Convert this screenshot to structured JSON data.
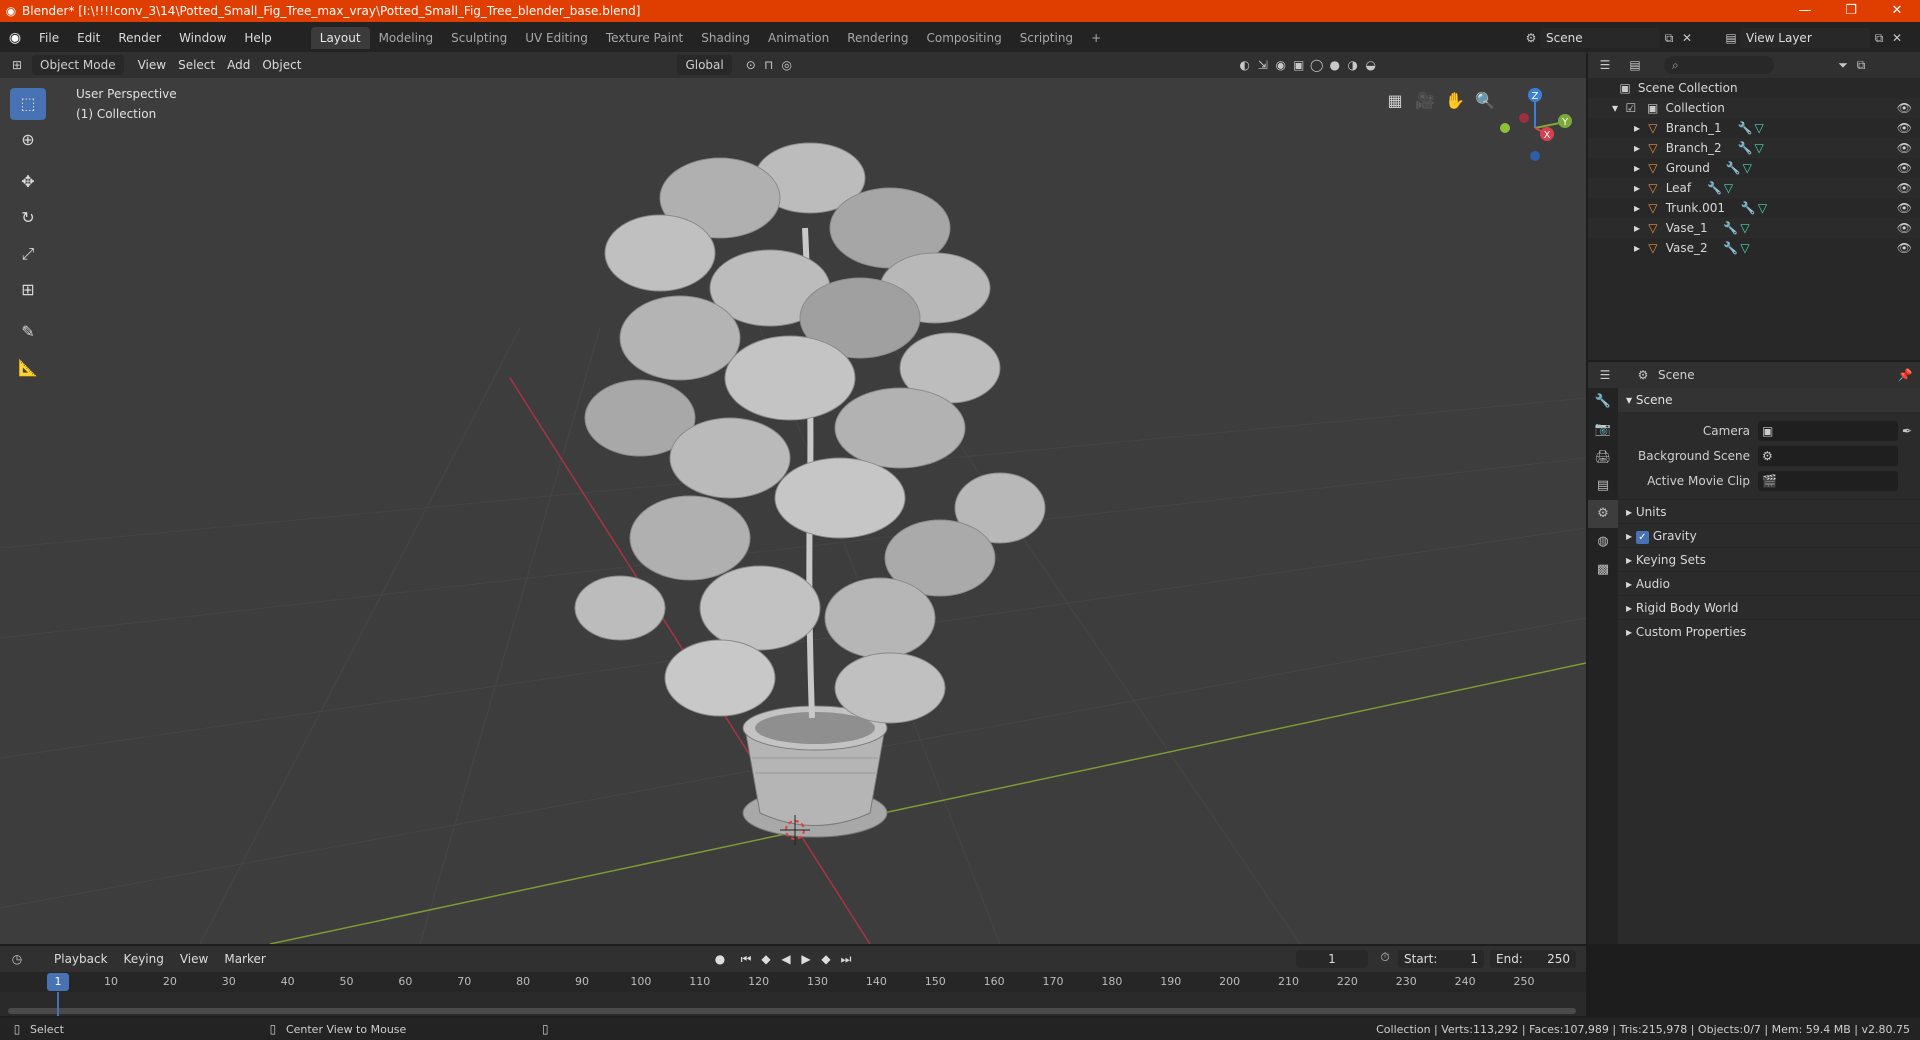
{
  "window": {
    "title": "Blender* [I:\\!!!!conv_3\\14\\Potted_Small_Fig_Tree_max_vray\\Potted_Small_Fig_Tree_blender_base.blend]",
    "minimize": "—",
    "maximize": "❐",
    "close": "✕"
  },
  "menu": {
    "items": [
      "File",
      "Edit",
      "Render",
      "Window",
      "Help"
    ],
    "workspaces": [
      "Layout",
      "Modeling",
      "Sculpting",
      "UV Editing",
      "Texture Paint",
      "Shading",
      "Animation",
      "Rendering",
      "Compositing",
      "Scripting"
    ],
    "active_workspace": "Layout",
    "add_workspace": "+",
    "scene": "Scene",
    "view_layer": "View Layer"
  },
  "viewport": {
    "mode": "Object Mode",
    "menus": [
      "View",
      "Select",
      "Add",
      "Object"
    ],
    "transform_orientation": "Global",
    "info_line1": "User Perspective",
    "info_line2": "(1) Collection",
    "gizmo": {
      "x": "X",
      "y": "Y",
      "z": "Z"
    }
  },
  "outliner": {
    "root": "Scene Collection",
    "collection": "Collection",
    "objects": [
      "Branch_1",
      "Branch_2",
      "Ground",
      "Leaf",
      "Trunk.001",
      "Vase_1",
      "Vase_2"
    ]
  },
  "properties": {
    "context": "Scene",
    "section_scene": "Scene",
    "fields": [
      {
        "label": "Camera",
        "value": ""
      },
      {
        "label": "Background Scene",
        "value": ""
      },
      {
        "label": "Active Movie Clip",
        "value": ""
      }
    ],
    "collapsed": [
      "Units",
      "Gravity",
      "Keying Sets",
      "Audio",
      "Rigid Body World",
      "Custom Properties"
    ]
  },
  "timeline": {
    "menus": [
      "Playback",
      "Keying",
      "View",
      "Marker"
    ],
    "current_frame": "1",
    "start_label": "Start:",
    "start": "1",
    "end_label": "End:",
    "end": "250",
    "ticks": [
      "1",
      "10",
      "20",
      "30",
      "40",
      "50",
      "60",
      "70",
      "80",
      "90",
      "100",
      "110",
      "120",
      "130",
      "140",
      "150",
      "160",
      "170",
      "180",
      "190",
      "200",
      "210",
      "220",
      "230",
      "240",
      "250"
    ]
  },
  "status": {
    "select": "Select",
    "center_view": "Center View to Mouse",
    "stats": "Collection | Verts:113,292 | Faces:107,989 | Tris:215,978 | Objects:0/7 | Mem: 59.4 MB | v2.80.75"
  },
  "colors": {
    "titlebar": "#e03d00",
    "accent": "#4772b3",
    "viewport_bg": "#3d3d3d",
    "x_axis": "#c8394b",
    "y_axis": "#8bb03a"
  }
}
